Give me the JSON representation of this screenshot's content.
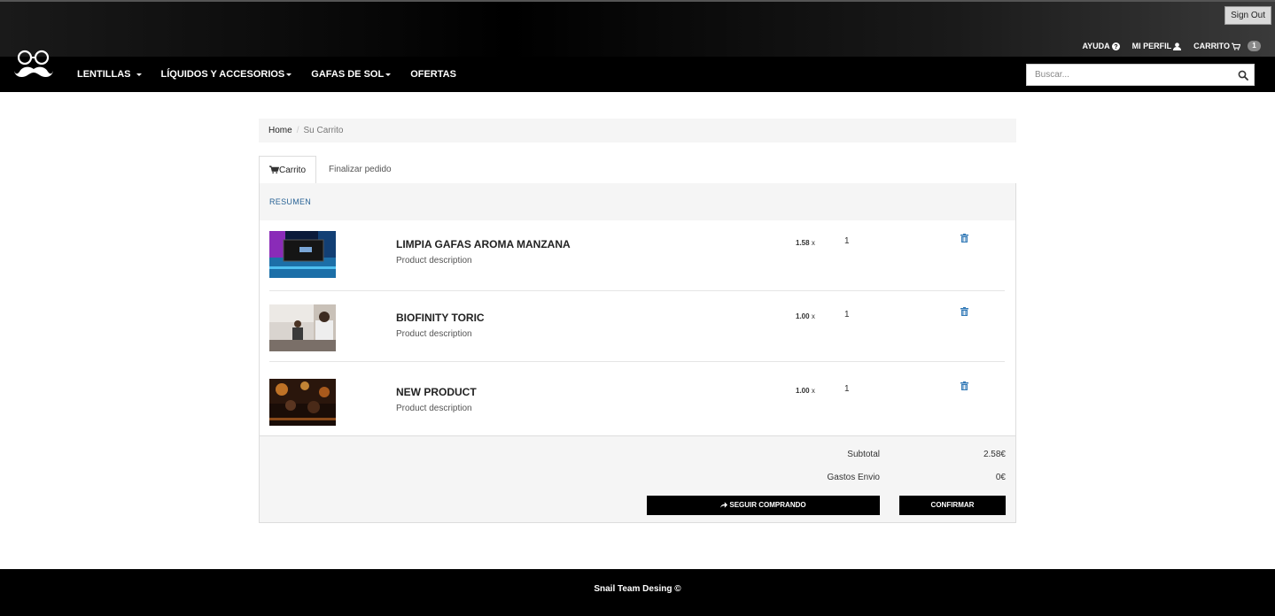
{
  "header": {
    "sign_out": "Sign Out",
    "links": {
      "help": "AYUDA",
      "profile": "MI PERFIL",
      "cart": "CARRITO",
      "cart_count": "1"
    },
    "nav": [
      {
        "label": "LENTILLAS",
        "dropdown": true
      },
      {
        "label": "LÍQUIDOS Y ACCESORIOS",
        "dropdown": true
      },
      {
        "label": "GAFAS DE SOL",
        "dropdown": true
      },
      {
        "label": "OFERTAS",
        "dropdown": false
      }
    ],
    "search_placeholder": "Buscar..."
  },
  "breadcrumb": {
    "home": "Home",
    "separator": "/",
    "current": "Su Carrito"
  },
  "tabs": {
    "cart": "Carrito",
    "checkout": "Finalizar pedido"
  },
  "cart": {
    "section_title": "RESUMEN",
    "items": [
      {
        "name": "LIMPIA GAFAS AROMA MANZANA",
        "description": "Product description",
        "price": "1.58",
        "price_suffix": "x",
        "qty": "1",
        "thumb_icon": "conference-screen-photo"
      },
      {
        "name": "BIOFINITY TORIC",
        "description": "Product description",
        "price": "1.00",
        "price_suffix": "x",
        "qty": "1",
        "thumb_icon": "office-people-photo"
      },
      {
        "name": "NEW PRODUCT",
        "description": "Product description",
        "price": "1.00",
        "price_suffix": "x",
        "qty": "1",
        "thumb_icon": "bar-crowd-photo"
      }
    ],
    "subtotal_label": "Subtotal",
    "subtotal_value": "2.58€",
    "shipping_label": "Gastos Envio",
    "shipping_value": "0€",
    "continue_button": "SEGUIR COMPRANDO",
    "confirm_button": "CONFIRMAR"
  },
  "footer": {
    "text": "Snail Team Desing ©"
  },
  "colors": {
    "accent_link": "#2a6496",
    "trash": "#337ab7",
    "bar": "#000000"
  }
}
